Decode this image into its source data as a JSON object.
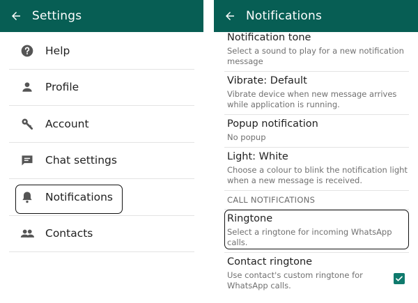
{
  "settings": {
    "title": "Settings",
    "items": [
      {
        "label": "Help",
        "icon": "help-circle-icon"
      },
      {
        "label": "Profile",
        "icon": "person-icon"
      },
      {
        "label": "Account",
        "icon": "key-icon"
      },
      {
        "label": "Chat settings",
        "icon": "chat-icon"
      },
      {
        "label": "Notifications",
        "icon": "bell-icon"
      },
      {
        "label": "Contacts",
        "icon": "people-icon"
      }
    ]
  },
  "notifications": {
    "title": "Notifications",
    "tone": {
      "title": "Notification tone",
      "subtitle": "Select a sound to play for a new notification message"
    },
    "vibrate": {
      "title": "Vibrate: Default",
      "subtitle": "Vibrate device when new message arrives while application is running."
    },
    "popup": {
      "title": "Popup notification",
      "subtitle": "No popup"
    },
    "light": {
      "title": "Light: White",
      "subtitle": "Choose a colour to blink the notification light when a new message is received."
    },
    "call_section": "CALL NOTIFICATIONS",
    "ringtone": {
      "title": "Ringtone",
      "subtitle": "Select a ringtone for incoming WhatsApp calls."
    },
    "contact_ringtone": {
      "title": "Contact ringtone",
      "subtitle": "Use contact's custom ringtone for WhatsApp calls.",
      "checked": true
    }
  },
  "colors": {
    "appbar": "#075e54",
    "accent": "#0f7a6d"
  }
}
